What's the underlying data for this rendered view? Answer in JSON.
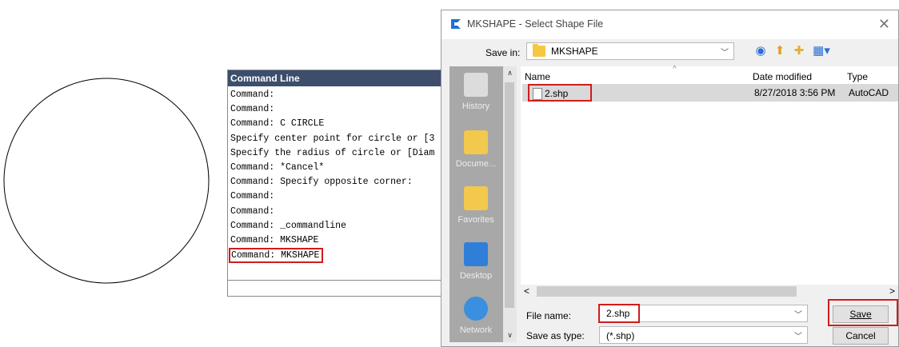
{
  "command_line": {
    "title": "Command Line",
    "lines": [
      "Command:",
      "Command:",
      "Command: C CIRCLE",
      "Specify center point for circle or [3",
      "Specify the radius of circle or [Diam",
      "Command: *Cancel*",
      "Command: Specify opposite corner:",
      "Command:",
      "Command:",
      "Command: _commandline",
      "Command: MKSHAPE",
      "Command: MKSHAPE"
    ]
  },
  "dialog": {
    "title": "MKSHAPE - Select Shape File",
    "close_icon": "close-icon",
    "save_in_label": "Save in:",
    "save_in_value": "MKSHAPE",
    "places": [
      "History",
      "Docume...",
      "Favorites",
      "Desktop",
      "Network"
    ],
    "columns": {
      "name": "Name",
      "date": "Date modified",
      "type": "Type"
    },
    "files": [
      {
        "name": "2.shp",
        "date": "8/27/2018 3:56 PM",
        "type": "AutoCAD"
      }
    ],
    "file_name_label": "File name:",
    "file_name_value": "2.shp",
    "save_as_type_label": "Save as type:",
    "save_as_type_value": "(*.shp)",
    "save_button": "Save",
    "cancel_button": "Cancel",
    "highlight_color": "#d01c1c"
  }
}
